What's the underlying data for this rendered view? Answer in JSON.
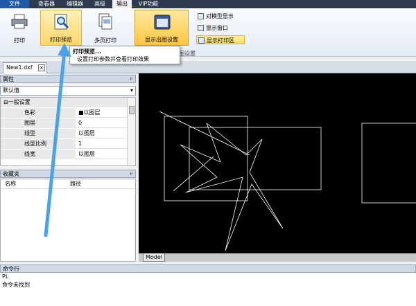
{
  "menu": {
    "file": "文件",
    "tabs": [
      "查看器",
      "编辑器",
      "高级",
      "输出",
      "VIP功能"
    ]
  },
  "ribbon": {
    "print_label": "打印",
    "print_preview_label": "打印预览",
    "multi_page_label": "多页打印",
    "show_layout_label": "显示出图设置",
    "opt_model": "对模型显示",
    "opt_window": "显示窗口",
    "opt_print_area": "显示打印区",
    "group_print": "打印",
    "group_layout": "出图设置"
  },
  "tooltip": {
    "title": "打印预览...",
    "desc": "设置打印参数并查看打印效果"
  },
  "doc_tab": {
    "name": "New1.dxf",
    "close": "×"
  },
  "properties": {
    "title": "属性",
    "pin": "ᵖ",
    "selected": "默认值",
    "rows": [
      {
        "key": "⊟一般设置",
        "value": "",
        "group": true
      },
      {
        "key": "色彩",
        "value": "■以图层"
      },
      {
        "key": "图层",
        "value": "0"
      },
      {
        "key": "线型",
        "value": "以图层"
      },
      {
        "key": "线型比例",
        "value": "1"
      },
      {
        "key": "线宽",
        "value": "以图层"
      }
    ]
  },
  "favorites": {
    "title": "收藏夹",
    "pin": "ᵖ",
    "col_name": "名称",
    "col_path": "路径"
  },
  "canvas": {
    "model_tab": "Model"
  },
  "command": {
    "title": "命令行",
    "lines": [
      "PL",
      "命令未找到"
    ]
  },
  "colors": {
    "accent_blue": "#1f5aa8",
    "highlight": "#ffd66b",
    "canvas_bg": "#000000",
    "arrow": "#4aa3e8"
  }
}
